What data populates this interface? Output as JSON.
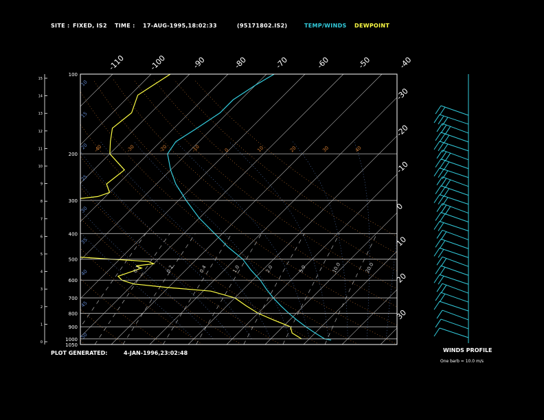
{
  "header": {
    "site_label": "SITE :",
    "site_value": "FIXED, IS2",
    "time_label": "TIME :",
    "time_value": "17-AUG-1995,18:02:33",
    "file_id": "(95171802.IS2)",
    "temp_legend": "TEMP/WINDS",
    "dew_legend": "DEWPOINT"
  },
  "footer": {
    "generated_label": "PLOT GENERATED:",
    "generated_value": "4-JAN-1996,23:02:48",
    "winds_title": "WINDS PROFILE",
    "winds_note": "One barb = 10.0 m/s"
  },
  "colors": {
    "temp": "#33ccdd",
    "dew": "#ffff44",
    "isobar": "#bbbbbb",
    "isotherm": "#bbbbbb",
    "dry_adiabat": "#d07a30",
    "moist_adiabat": "#5e84c8",
    "mixing_ratio": "#cccccc",
    "frame": "#ffffff"
  },
  "chart_data": {
    "type": "skew-t",
    "left_axis_ticks": [
      "0",
      "1",
      "2",
      "3",
      "4",
      "5",
      "6",
      "7",
      "8",
      "9",
      "10",
      "11",
      "12",
      "13",
      "14",
      "15"
    ],
    "pressure_labels": [
      "100",
      "200",
      "300",
      "400",
      "500",
      "600",
      "700",
      "800",
      "900",
      "1000",
      "1050"
    ],
    "right_axis_ticks": [
      "-30",
      "-20",
      "-10",
      "0",
      "10",
      "20",
      "30"
    ],
    "top_axis_ticks": [
      "-110",
      "-100",
      "-90",
      "-80",
      "-70",
      "-60",
      "-50",
      "-40"
    ],
    "moist_adiabat_labels": [
      "10",
      "15",
      "20",
      "25",
      "30",
      "35",
      "40",
      "45",
      "50"
    ],
    "dry_adiabat_labels": [
      "-40",
      "-30",
      "-20",
      "-10",
      "0",
      "10",
      "20",
      "30",
      "40"
    ],
    "mixing_ratio_labels": [
      "0.1",
      "0.2",
      "0.4",
      "1.0",
      "2.0",
      "5.0",
      "10.0",
      "20.0"
    ],
    "temperature_profile": [
      {
        "p": 100,
        "t": -58
      },
      {
        "p": 110,
        "t": -60
      },
      {
        "p": 125,
        "t": -62
      },
      {
        "p": 140,
        "t": -62
      },
      {
        "p": 160,
        "t": -64
      },
      {
        "p": 180,
        "t": -66
      },
      {
        "p": 200,
        "t": -65
      },
      {
        "p": 230,
        "t": -60
      },
      {
        "p": 260,
        "t": -55
      },
      {
        "p": 300,
        "t": -48
      },
      {
        "p": 350,
        "t": -40
      },
      {
        "p": 400,
        "t": -32
      },
      {
        "p": 450,
        "t": -25
      },
      {
        "p": 500,
        "t": -18
      },
      {
        "p": 550,
        "t": -13
      },
      {
        "p": 600,
        "t": -8
      },
      {
        "p": 650,
        "t": -4
      },
      {
        "p": 700,
        "t": 0
      },
      {
        "p": 750,
        "t": 4
      },
      {
        "p": 800,
        "t": 8
      },
      {
        "p": 850,
        "t": 12
      },
      {
        "p": 900,
        "t": 16
      },
      {
        "p": 950,
        "t": 20
      },
      {
        "p": 1000,
        "t": 24
      },
      {
        "p": 1010,
        "t": 26
      }
    ],
    "dewpoint_profile": [
      {
        "p": 100,
        "t": -85
      },
      {
        "p": 120,
        "t": -88
      },
      {
        "p": 140,
        "t": -85
      },
      {
        "p": 160,
        "t": -86
      },
      {
        "p": 180,
        "t": -83
      },
      {
        "p": 200,
        "t": -80
      },
      {
        "p": 230,
        "t": -72
      },
      {
        "p": 260,
        "t": -73
      },
      {
        "p": 280,
        "t": -70
      },
      {
        "p": 290,
        "t": -72
      },
      {
        "p": 300,
        "t": -80
      },
      {
        "p": 320,
        "t": -78
      },
      {
        "p": 340,
        "t": -90
      },
      {
        "p": 360,
        "t": -95
      },
      {
        "p": 390,
        "t": -104
      },
      {
        "p": 400,
        "t": -105
      },
      {
        "p": 420,
        "t": -95
      },
      {
        "p": 440,
        "t": -94
      },
      {
        "p": 460,
        "t": -90
      },
      {
        "p": 470,
        "t": -80
      },
      {
        "p": 480,
        "t": -70
      },
      {
        "p": 490,
        "t": -62
      },
      {
        "p": 500,
        "t": -52
      },
      {
        "p": 510,
        "t": -42
      },
      {
        "p": 520,
        "t": -40
      },
      {
        "p": 530,
        "t": -44
      },
      {
        "p": 540,
        "t": -42
      },
      {
        "p": 560,
        "t": -44
      },
      {
        "p": 580,
        "t": -46
      },
      {
        "p": 600,
        "t": -44
      },
      {
        "p": 620,
        "t": -40
      },
      {
        "p": 640,
        "t": -30
      },
      {
        "p": 660,
        "t": -18
      },
      {
        "p": 700,
        "t": -10
      },
      {
        "p": 750,
        "t": -5
      },
      {
        "p": 800,
        "t": 0
      },
      {
        "p": 850,
        "t": 6
      },
      {
        "p": 900,
        "t": 12
      },
      {
        "p": 950,
        "t": 14
      },
      {
        "p": 1000,
        "t": 18
      }
    ],
    "wind_levels_km": [
      0.5,
      1,
      1.5,
      2,
      2.5,
      3,
      3.5,
      4,
      4.5,
      5,
      5.5,
      6,
      6.5,
      7,
      7.5,
      8,
      8.5,
      9,
      9.5,
      10,
      10.5,
      11,
      11.5,
      12,
      12.5,
      13
    ],
    "wind_speed_barbs": [
      1,
      1,
      1,
      1,
      2,
      2,
      2,
      2,
      2,
      2,
      2,
      2,
      2,
      2,
      3,
      3,
      3,
      3,
      3,
      3,
      3,
      3,
      3,
      3,
      3,
      2
    ]
  }
}
